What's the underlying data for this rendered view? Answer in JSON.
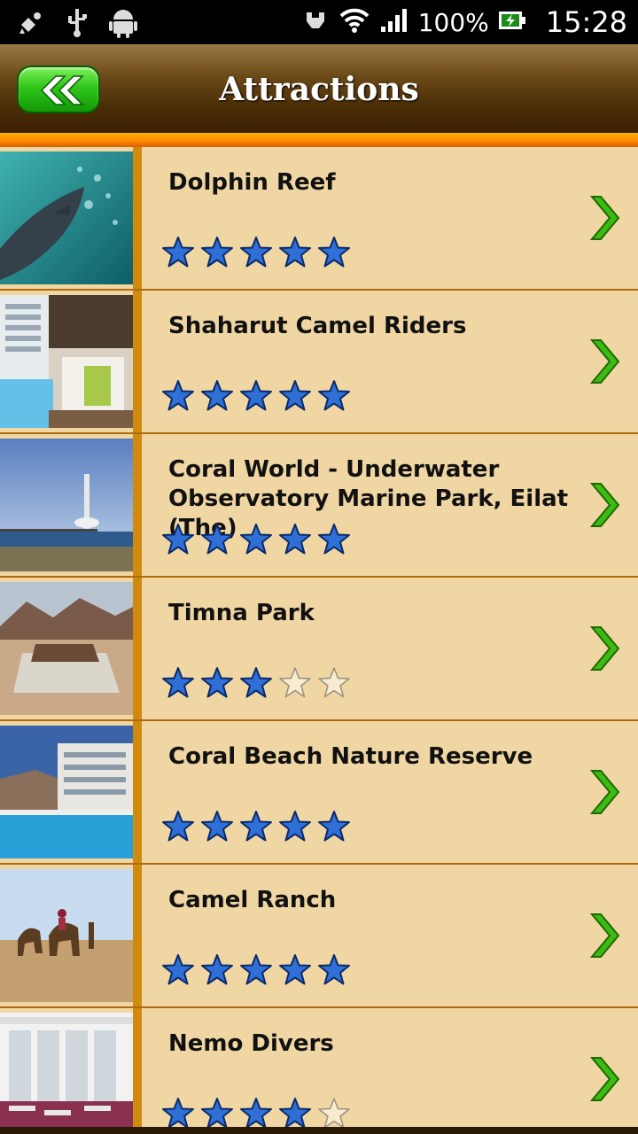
{
  "status_bar": {
    "battery_percent": "100%",
    "time": "15:28",
    "icons": [
      "satellite-dish-icon",
      "usb-icon",
      "android-icon",
      "phone-vibrate-icon",
      "wifi-icon",
      "signal-icon",
      "battery-charging-icon"
    ]
  },
  "header": {
    "title": "Attractions",
    "back_icon": "double-chevron-left-icon"
  },
  "colors": {
    "header_dark": "#3a2004",
    "accent_orange": "#ff8a00",
    "row_bg": "#efd6a3",
    "divider": "#b06a10",
    "star_fill": "#2f6fd6",
    "chevron_green": "#3dbb12"
  },
  "attractions": [
    {
      "name": "Dolphin Reef",
      "rating": 5
    },
    {
      "name": "Shaharut Camel Riders",
      "rating": 5
    },
    {
      "name": "Coral World - Underwater Observatory Marine Park, Eilat (The)",
      "rating": 5
    },
    {
      "name": "Timna Park",
      "rating": 3
    },
    {
      "name": "Coral Beach Nature Reserve",
      "rating": 5
    },
    {
      "name": "Camel Ranch",
      "rating": 5
    },
    {
      "name": "Nemo Divers",
      "rating": 4
    }
  ]
}
